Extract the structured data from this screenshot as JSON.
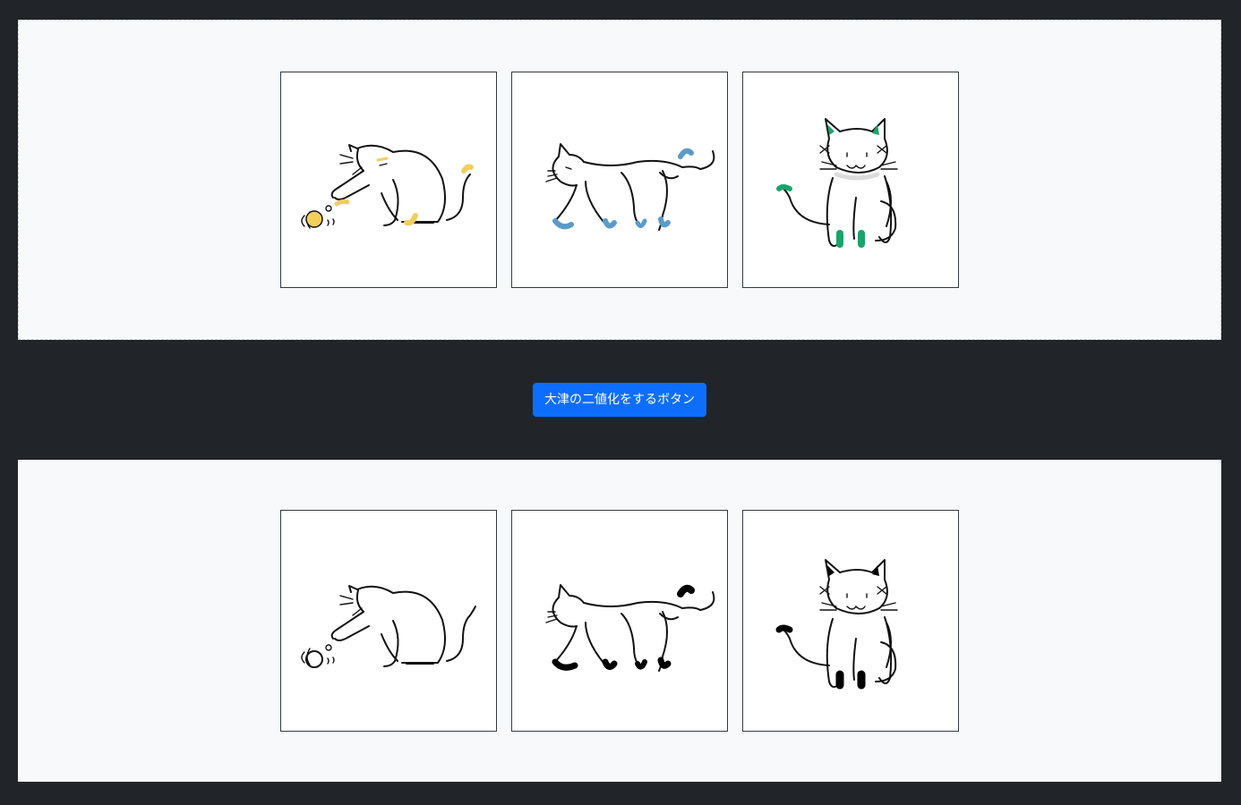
{
  "original_panel": {
    "images": [
      {
        "subject": "cat-playing-with-ball",
        "accent_color": "#f2cf5b"
      },
      {
        "subject": "cat-walking",
        "accent_color": "#5b9bc8"
      },
      {
        "subject": "cat-sitting",
        "accent_color": "#1aa36b"
      }
    ]
  },
  "action_button": {
    "label": "大津の二値化をするボタン",
    "color": "#0d6efd"
  },
  "result_panel": {
    "images": [
      {
        "subject": "cat-playing-with-ball-binarized",
        "accent_color": "#000000"
      },
      {
        "subject": "cat-walking-binarized",
        "accent_color": "#000000"
      },
      {
        "subject": "cat-sitting-binarized",
        "accent_color": "#000000"
      }
    ]
  }
}
